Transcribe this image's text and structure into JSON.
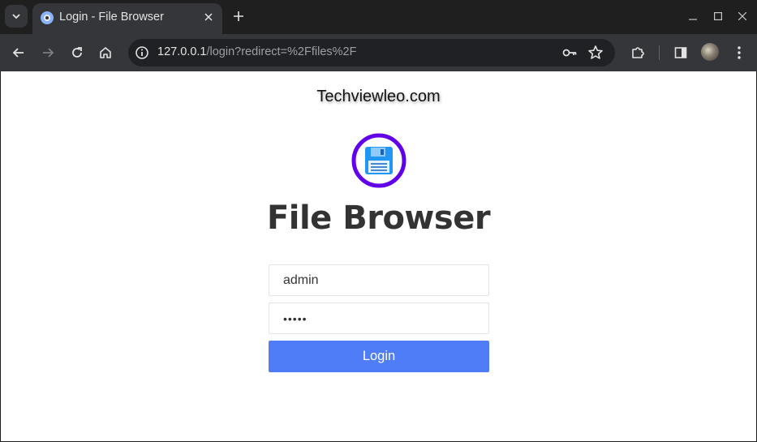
{
  "browser": {
    "tab": {
      "title": "Login - File Browser"
    },
    "omnibox": {
      "url_host": "127.0.0.1",
      "url_path": "/login?redirect=%2Ffiles%2F"
    }
  },
  "page": {
    "brand_text": "Techviewleo.com",
    "app_title": "File Browser",
    "username": "admin",
    "password_mask": "•••••",
    "login_label": "Login",
    "logo_icon": "floppy-disk-icon",
    "accent_color": "#4f7cf7",
    "logo_ring_color": "#6200ea"
  }
}
